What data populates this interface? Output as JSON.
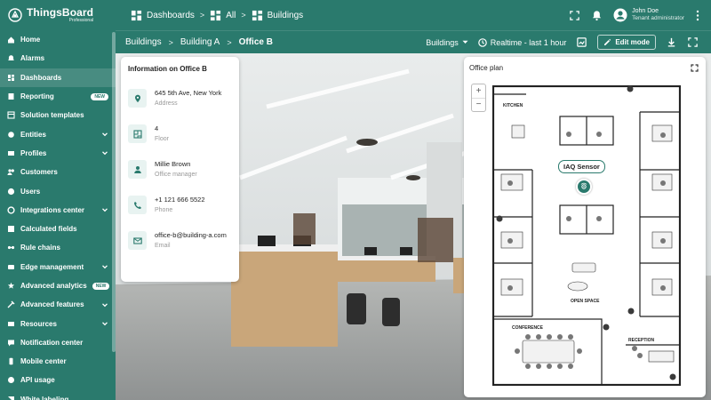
{
  "app": {
    "name": "ThingsBoard",
    "edition": "Professional"
  },
  "sidebar": {
    "items": [
      {
        "label": "Home",
        "icon": "home-icon"
      },
      {
        "label": "Alarms",
        "icon": "alarm-icon"
      },
      {
        "label": "Dashboards",
        "icon": "dashboard-icon",
        "active": true
      },
      {
        "label": "Reporting",
        "icon": "report-icon",
        "badge": "NEW"
      },
      {
        "label": "Solution templates",
        "icon": "template-icon"
      },
      {
        "label": "Entities",
        "icon": "entities-icon",
        "expandable": true
      },
      {
        "label": "Profiles",
        "icon": "profiles-icon",
        "expandable": true
      },
      {
        "label": "Customers",
        "icon": "customers-icon"
      },
      {
        "label": "Users",
        "icon": "users-icon"
      },
      {
        "label": "Integrations center",
        "icon": "integrations-icon",
        "expandable": true
      },
      {
        "label": "Calculated fields",
        "icon": "calculated-icon"
      },
      {
        "label": "Rule chains",
        "icon": "rule-chain-icon"
      },
      {
        "label": "Edge management",
        "icon": "edge-icon",
        "expandable": true
      },
      {
        "label": "Advanced analytics",
        "icon": "analytics-icon",
        "badge": "NEW"
      },
      {
        "label": "Advanced features",
        "icon": "features-icon",
        "expandable": true
      },
      {
        "label": "Resources",
        "icon": "resources-icon",
        "expandable": true
      },
      {
        "label": "Notification center",
        "icon": "notification-icon"
      },
      {
        "label": "Mobile center",
        "icon": "mobile-icon"
      },
      {
        "label": "API usage",
        "icon": "api-icon"
      },
      {
        "label": "White labeling",
        "icon": "white-label-icon"
      }
    ]
  },
  "topbar": {
    "breadcrumbs": [
      "Dashboards",
      "All",
      "Buildings"
    ],
    "user_name": "John Doe",
    "user_role": "Tenant administrator"
  },
  "dashbar": {
    "states": [
      "Buildings",
      "Building A",
      "Office B"
    ],
    "state_select": "Buildings",
    "timewindow": "Realtime - last 1 hour",
    "edit_label": "Edit mode"
  },
  "info": {
    "title": "Information on Office B",
    "rows": [
      {
        "value": "645 5th Ave, New York",
        "label": "Address",
        "icon": "location-icon"
      },
      {
        "value": "4",
        "label": "Floor",
        "icon": "floor-icon"
      },
      {
        "value": "Millie Brown",
        "label": "Office manager",
        "icon": "person-icon"
      },
      {
        "value": "+1 121 666 5522",
        "label": "Phone",
        "icon": "phone-icon"
      },
      {
        "value": "office-b@building-a.com",
        "label": "Email",
        "icon": "email-icon"
      }
    ]
  },
  "plan": {
    "title": "Office plan",
    "zoom_in": "+",
    "zoom_out": "−",
    "sensor_label": "IAQ Sensor",
    "rooms": [
      "KITCHEN",
      "OPEN SPACE",
      "CONFERENCE",
      "RECEPTION"
    ]
  },
  "colors": {
    "brand": "#2a7a6d",
    "accent_light": "#e8f3f1"
  }
}
